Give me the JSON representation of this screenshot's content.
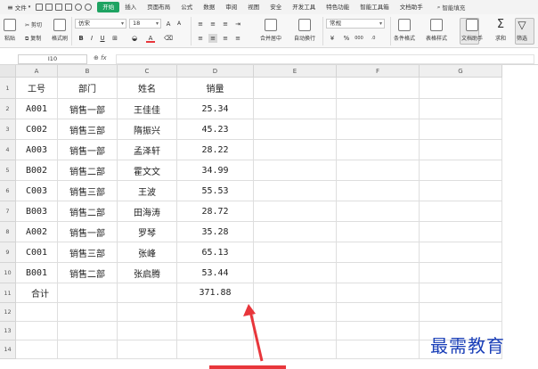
{
  "menu": {
    "file": "文件",
    "tabs": [
      "开始",
      "插入",
      "页面布局",
      "公式",
      "数据",
      "审阅",
      "视图",
      "安全",
      "开发工具",
      "特色功能",
      "智能工具箱",
      "文档助手"
    ],
    "active_tab": "开始",
    "search": "智能填充"
  },
  "ribbon": {
    "paste": "粘贴",
    "cut": "剪切",
    "copy": "复制",
    "format_painter": "格式刷",
    "font_name": "仿宋",
    "font_size": "18",
    "merge_center": "合并居中",
    "wrap_text": "自动换行",
    "number_format": "常规",
    "conditional_format": "条件格式",
    "table_style": "表格样式",
    "doc_helper": "文档助手",
    "sum": "求和",
    "filter": "筛选"
  },
  "formula_bar": {
    "name_box": "I10",
    "fx": "fx",
    "value": ""
  },
  "grid": {
    "columns": [
      "A",
      "B",
      "C",
      "D",
      "E",
      "F",
      "G"
    ],
    "rows": [
      "1",
      "2",
      "3",
      "4",
      "5",
      "6",
      "7",
      "8",
      "9",
      "10",
      "11",
      "12",
      "13",
      "14"
    ],
    "header": [
      "工号",
      "部门",
      "姓名",
      "销量"
    ],
    "data": [
      [
        "A001",
        "销售一部",
        "王佳佳",
        "25.34"
      ],
      [
        "C002",
        "销售三部",
        "隋振兴",
        "45.23"
      ],
      [
        "A003",
        "销售一部",
        "孟泽轩",
        "28.22"
      ],
      [
        "B002",
        "销售二部",
        "霍文文",
        "34.99"
      ],
      [
        "C003",
        "销售三部",
        "王波",
        "55.53"
      ],
      [
        "B003",
        "销售二部",
        "田海涛",
        "28.72"
      ],
      [
        "A002",
        "销售一部",
        "罗琴",
        "35.28"
      ],
      [
        "C001",
        "销售三部",
        "张峰",
        "65.13"
      ],
      [
        "B001",
        "销售二部",
        "张启腾",
        "53.44"
      ]
    ],
    "total_label": "合计",
    "total_value": "371.88"
  },
  "colors": {
    "active_tab": "#1ea362",
    "highlight_bar": "#e8363b",
    "arrow": "#e8363b",
    "watermark": "#1a3fb8"
  },
  "watermark": "最需教育"
}
